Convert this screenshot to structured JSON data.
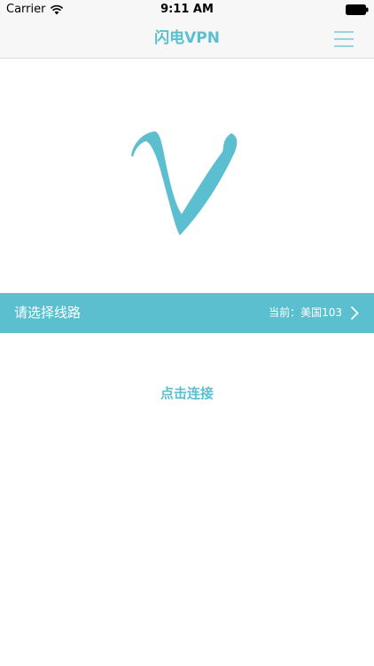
{
  "status_bar": {
    "carrier": "Carrier",
    "time": "9:11 AM",
    "wifi_icon": "wifi-icon",
    "battery_icon": "battery-icon"
  },
  "nav": {
    "title": "闪电VPN",
    "menu_icon": "hamburger-menu-icon"
  },
  "logo": {
    "icon": "v-logo-icon"
  },
  "route": {
    "label": "请选择线路",
    "current": "当前：美国103",
    "chevron_icon": "chevron-right-icon"
  },
  "connect": {
    "label": "点击连接"
  },
  "colors": {
    "accent": "#5bbfcf",
    "nav_background": "#f7f7f7",
    "background": "#ffffff"
  }
}
